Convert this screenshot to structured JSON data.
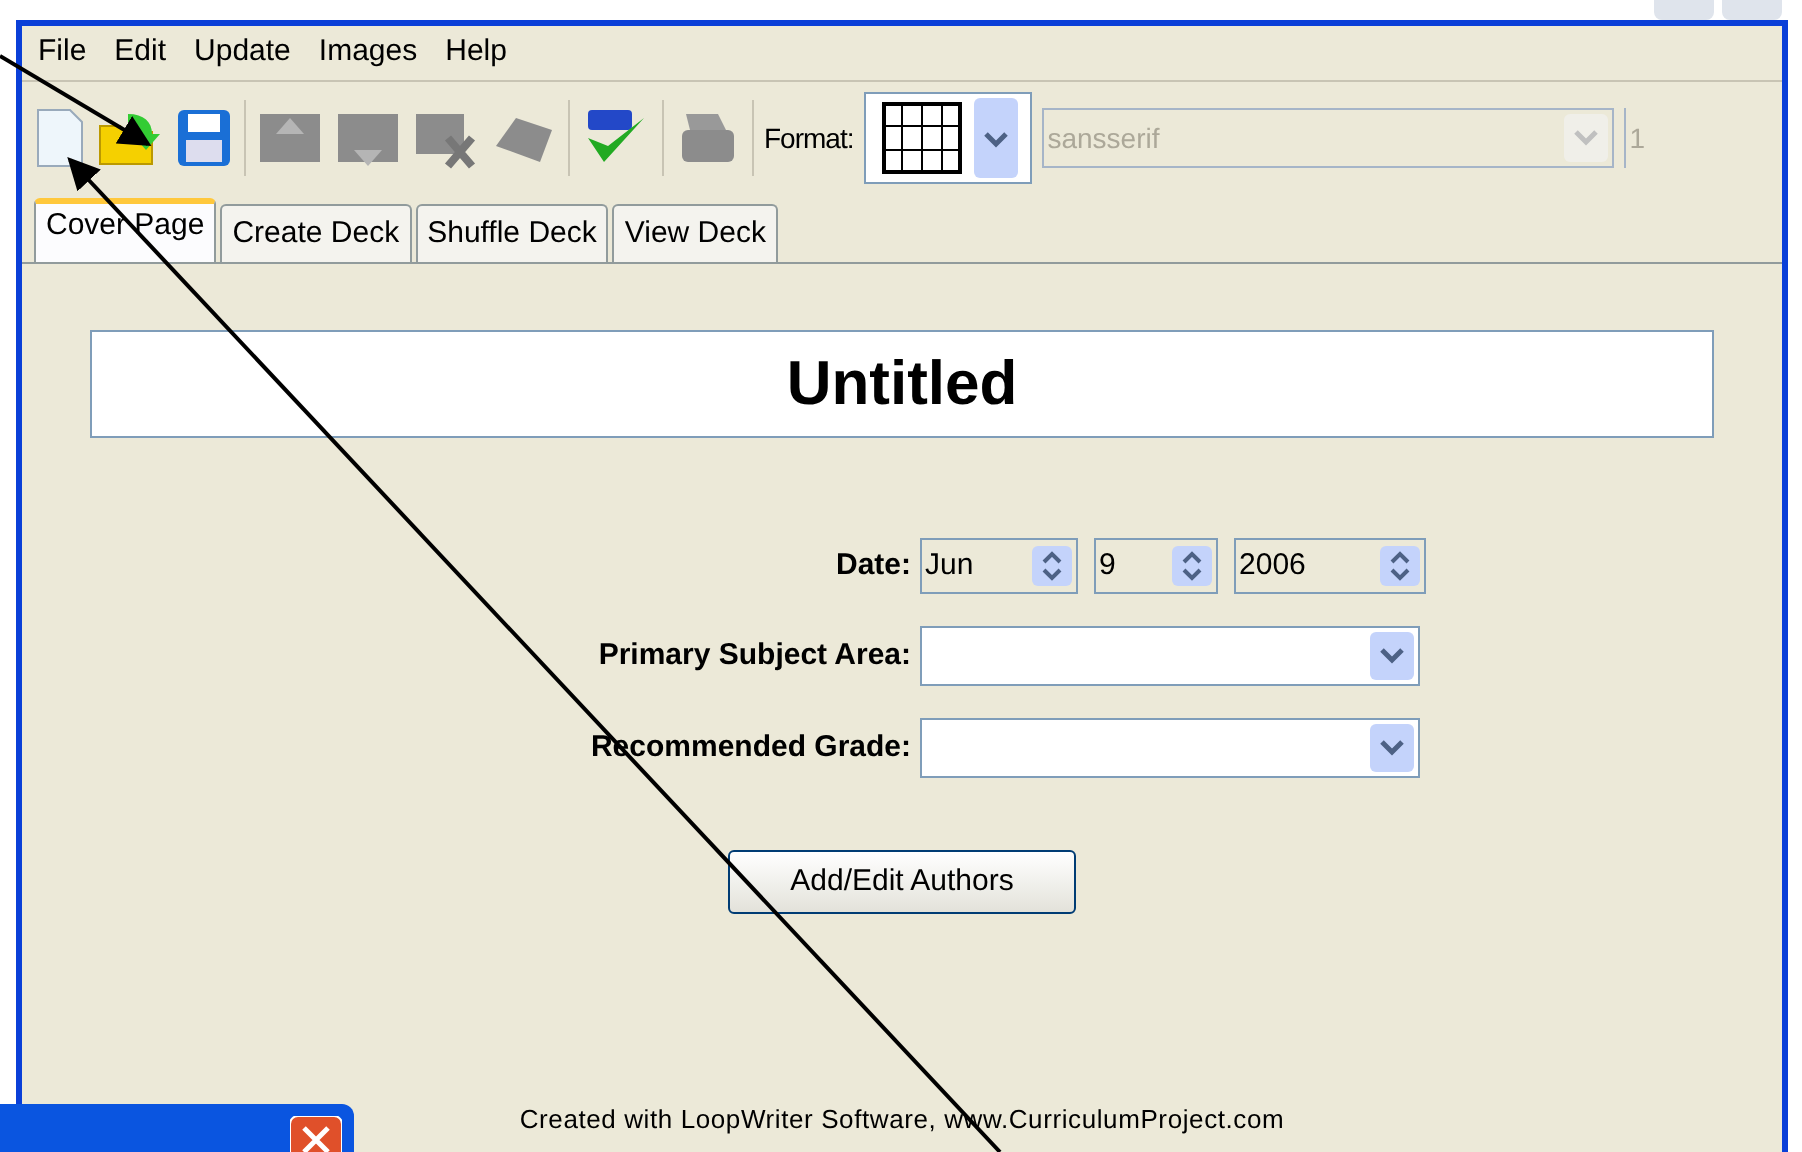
{
  "menu": [
    "File",
    "Edit",
    "Update",
    "Images",
    "Help"
  ],
  "toolbar": [
    {
      "kind": "new",
      "disabled": false
    },
    {
      "kind": "open",
      "disabled": false
    },
    {
      "kind": "save",
      "disabled": false
    },
    {
      "kind": "up",
      "disabled": true
    },
    {
      "kind": "down",
      "disabled": true
    },
    {
      "kind": "delete",
      "disabled": true
    },
    {
      "kind": "cards",
      "disabled": true
    },
    {
      "kind": "spell",
      "disabled": false
    },
    {
      "kind": "print",
      "disabled": true
    }
  ],
  "format": {
    "label": "Format:",
    "font": "sansserif",
    "font_disabled": true,
    "size": "1"
  },
  "tabs": [
    {
      "label": "Cover Page",
      "selected": true
    },
    {
      "label": "Create Deck",
      "selected": false
    },
    {
      "label": "Shuffle Deck",
      "selected": false
    },
    {
      "label": "View Deck",
      "selected": false
    }
  ],
  "title": "Untitled",
  "date": {
    "label": "Date:",
    "month": "Jun",
    "day": "9",
    "year": "2006"
  },
  "fields": [
    {
      "label": "Primary Subject Area:"
    },
    {
      "label": "Recommended Grade:"
    }
  ],
  "button": "Add/Edit Authors",
  "footer": "Created with LoopWriter Software, www.CurriculumProject.com"
}
